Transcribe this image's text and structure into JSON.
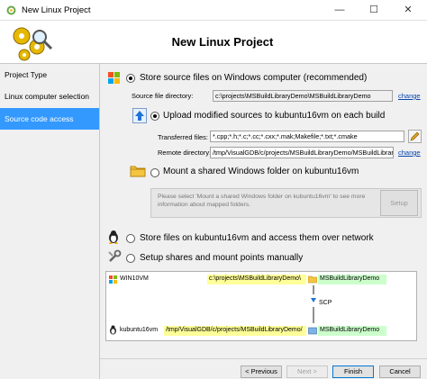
{
  "window": {
    "title": "New Linux Project",
    "minimize_glyph": "—",
    "maximize_glyph": "☐",
    "close_glyph": "✕"
  },
  "header": {
    "title": "New Linux Project"
  },
  "sidebar": {
    "items": [
      {
        "label": "Project Type"
      },
      {
        "label": "Linux computer selection"
      },
      {
        "label": "Source code access"
      }
    ],
    "active_index": 2
  },
  "options": {
    "store_windows": {
      "label": "Store source files on Windows computer (recommended)",
      "source_dir_label": "Source file directory:",
      "source_dir_value": "c:\\projects\\MSBuildLibraryDemo\\MSBuildLibraryDemo",
      "change_label": "change"
    },
    "upload": {
      "label": "Upload modified sources to kubuntu16vm on each build",
      "transferred_label": "Transferred files:",
      "transferred_value": "*.cpp;*.h;*.c;*.cc;*.cxx;*.mak;Makefile;*.txt;*.cmake",
      "remote_label": "Remote directory:",
      "remote_value": "/tmp/VisualGDB/c/projects/MSBuildLibraryDemo/MSBuildLibrar",
      "change_label": "change"
    },
    "mount_shared": {
      "label": "Mount a shared Windows folder on kubuntu16vm",
      "info_text": "Please select 'Mount a shared Windows folder on kubuntu16vm' to see more information about mapped folders.",
      "setup_label": "Setup"
    },
    "store_linux": {
      "label": "Store files on kubuntu16vm and access them over network"
    },
    "setup_shares": {
      "label": "Setup shares and mount points manually"
    }
  },
  "diagram": {
    "windows_host": "WIN10VM",
    "windows_path": "c:\\projects\\MSBuildLibraryDemo\\",
    "windows_folder": "MSBuildLibraryDemo",
    "transfer": "SCP",
    "linux_host": "kubuntu16vm",
    "linux_path": "/tmp/VisualGDB/c/projects/MSBuildLibraryDemo/",
    "linux_folder": "MSBuildLibraryDemo"
  },
  "footer": {
    "previous": "< Previous",
    "next": "Next >",
    "finish": "Finish",
    "cancel": "Cancel"
  }
}
